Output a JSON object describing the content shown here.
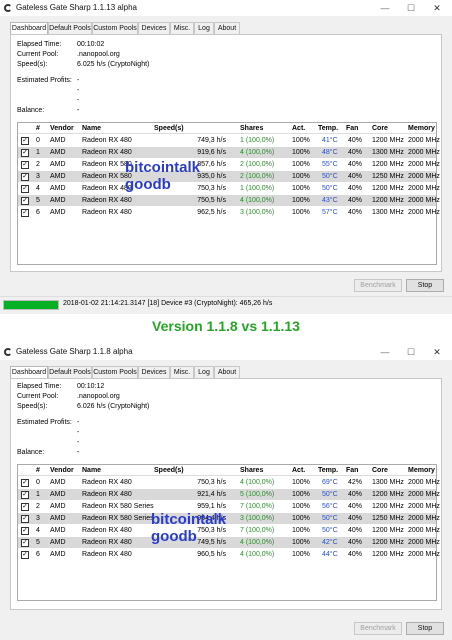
{
  "caption": "Version 1.1.8 vs 1.1.13",
  "windows": [
    {
      "title": "Gateless Gate Sharp 1.1.13 alpha",
      "tabs": [
        "Dashboard",
        "Default Pools",
        "Custom Pools",
        "Devices",
        "Misc.",
        "Log",
        "About"
      ],
      "info": {
        "elapsed_label": "Elapsed Time:",
        "elapsed": "00:10:02",
        "pool_label": "Current Pool:",
        "pool": ".nanopool.org",
        "speed_label": "Speed(s):",
        "speed": "6.025 h/s (CryptoNight)",
        "profits_label": "Estimated Profits:",
        "profits": [
          "-",
          "-",
          "-",
          "-"
        ],
        "balance_label": "Balance:",
        "balance": "-"
      },
      "columns": [
        "#",
        "Vendor",
        "Name",
        "Speed(s)",
        "Shares",
        "Act.",
        "Temp.",
        "Fan",
        "Core",
        "Memory"
      ],
      "rows": [
        {
          "id": "0",
          "vendor": "AMD",
          "name": "Radeon RX 480",
          "speed": "749,3 h/s",
          "shares": "1 (100,0%)",
          "act": "100%",
          "temp": "41°C",
          "fan": "40%",
          "core": "1200 MHz",
          "memory": "2000 MHz"
        },
        {
          "id": "1",
          "vendor": "AMD",
          "name": "Radeon RX 480",
          "speed": "919,6 h/s",
          "shares": "4 (100,0%)",
          "act": "100%",
          "temp": "48°C",
          "fan": "40%",
          "core": "1300 MHz",
          "memory": "2000 MHz"
        },
        {
          "id": "2",
          "vendor": "AMD",
          "name": "Radeon RX 580",
          "speed": "857,6 h/s",
          "shares": "2 (100,0%)",
          "act": "100%",
          "temp": "55°C",
          "fan": "40%",
          "core": "1200 MHz",
          "memory": "2000 MHz"
        },
        {
          "id": "3",
          "vendor": "AMD",
          "name": "Radeon RX 580",
          "speed": "935,0 h/s",
          "shares": "2 (100,0%)",
          "act": "100%",
          "temp": "50°C",
          "fan": "40%",
          "core": "1250 MHz",
          "memory": "2000 MHz"
        },
        {
          "id": "4",
          "vendor": "AMD",
          "name": "Radeon RX 480",
          "speed": "750,3 h/s",
          "shares": "1 (100,0%)",
          "act": "100%",
          "temp": "50°C",
          "fan": "40%",
          "core": "1200 MHz",
          "memory": "2000 MHz"
        },
        {
          "id": "5",
          "vendor": "AMD",
          "name": "Radeon RX 480",
          "speed": "750,5 h/s",
          "shares": "4 (100,0%)",
          "act": "100%",
          "temp": "43°C",
          "fan": "40%",
          "core": "1200 MHz",
          "memory": "2000 MHz"
        },
        {
          "id": "6",
          "vendor": "AMD",
          "name": "Radeon RX 480",
          "speed": "962,5 h/s",
          "shares": "3 (100,0%)",
          "act": "100%",
          "temp": "57°C",
          "fan": "40%",
          "core": "1300 MHz",
          "memory": "2000 MHz"
        }
      ],
      "watermark": [
        "bitcointalk",
        "goodb"
      ],
      "buttons": {
        "benchmark": "Benchmark",
        "stop": "Stop"
      },
      "status": {
        "text": "2018-01-02 21:14:21.3147 [18] Device #3 (CryptoNight): 465,26 h/s",
        "progress": 1.0
      }
    },
    {
      "title": "Gateless Gate Sharp 1.1.8 alpha",
      "tabs": [
        "Dashboard",
        "Default Pools",
        "Custom Pools",
        "Devices",
        "Misc.",
        "Log",
        "About"
      ],
      "info": {
        "elapsed_label": "Elapsed Time:",
        "elapsed": "00:10:12",
        "pool_label": "Current Pool:",
        "pool": ".nanopool.org",
        "speed_label": "Speed(s):",
        "speed": "6.026 h/s (CryptoNight)",
        "profits_label": "Estimated Profits:",
        "profits": [
          "-",
          "-",
          "-",
          "-"
        ],
        "balance_label": "Balance:",
        "balance": "-"
      },
      "columns": [
        "#",
        "Vendor",
        "Name",
        "Speed(s)",
        "Shares",
        "Act.",
        "Temp.",
        "Fan",
        "Core",
        "Memory"
      ],
      "rows": [
        {
          "id": "0",
          "vendor": "AMD",
          "name": "Radeon RX 480",
          "speed": "750,3 h/s",
          "shares": "4 (100,0%)",
          "act": "100%",
          "temp": "69°C",
          "fan": "42%",
          "core": "1300 MHz",
          "memory": "2000 MHz"
        },
        {
          "id": "1",
          "vendor": "AMD",
          "name": "Radeon RX 480",
          "speed": "921,4 h/s",
          "shares": "5 (100,0%)",
          "act": "100%",
          "temp": "50°C",
          "fan": "40%",
          "core": "1200 MHz",
          "memory": "2000 MHz"
        },
        {
          "id": "2",
          "vendor": "AMD",
          "name": "Radeon RX 580 Series",
          "speed": "959,1 h/s",
          "shares": "7 (100,0%)",
          "act": "100%",
          "temp": "56°C",
          "fan": "40%",
          "core": "1200 MHz",
          "memory": "2000 MHz"
        },
        {
          "id": "3",
          "vendor": "AMD",
          "name": "Radeon RX 580 Series",
          "speed": "934,4 h/s",
          "shares": "3 (100,0%)",
          "act": "100%",
          "temp": "50°C",
          "fan": "40%",
          "core": "1250 MHz",
          "memory": "2000 MHz"
        },
        {
          "id": "4",
          "vendor": "AMD",
          "name": "Radeon RX 480",
          "speed": "750,3 h/s",
          "shares": "7 (100,0%)",
          "act": "100%",
          "temp": "50°C",
          "fan": "40%",
          "core": "1200 MHz",
          "memory": "2000 MHz"
        },
        {
          "id": "5",
          "vendor": "AMD",
          "name": "Radeon RX 480",
          "speed": "749,5 h/s",
          "shares": "4 (100,0%)",
          "act": "100%",
          "temp": "42°C",
          "fan": "40%",
          "core": "1200 MHz",
          "memory": "2000 MHz"
        },
        {
          "id": "6",
          "vendor": "AMD",
          "name": "Radeon RX 480",
          "speed": "960,5 h/s",
          "shares": "4 (100,0%)",
          "act": "100%",
          "temp": "44°C",
          "fan": "40%",
          "core": "1200 MHz",
          "memory": "2000 MHz"
        }
      ],
      "watermark": [
        "bitcointalk",
        "goodb"
      ],
      "buttons": {
        "benchmark": "Benchmark",
        "stop": "Stop"
      }
    }
  ],
  "colors": {
    "shares_text": "#2e8b2e",
    "temp_text": "#2a50c8",
    "watermark": "#2a3ccc",
    "caption": "#26a526",
    "progress": "#06b025"
  }
}
